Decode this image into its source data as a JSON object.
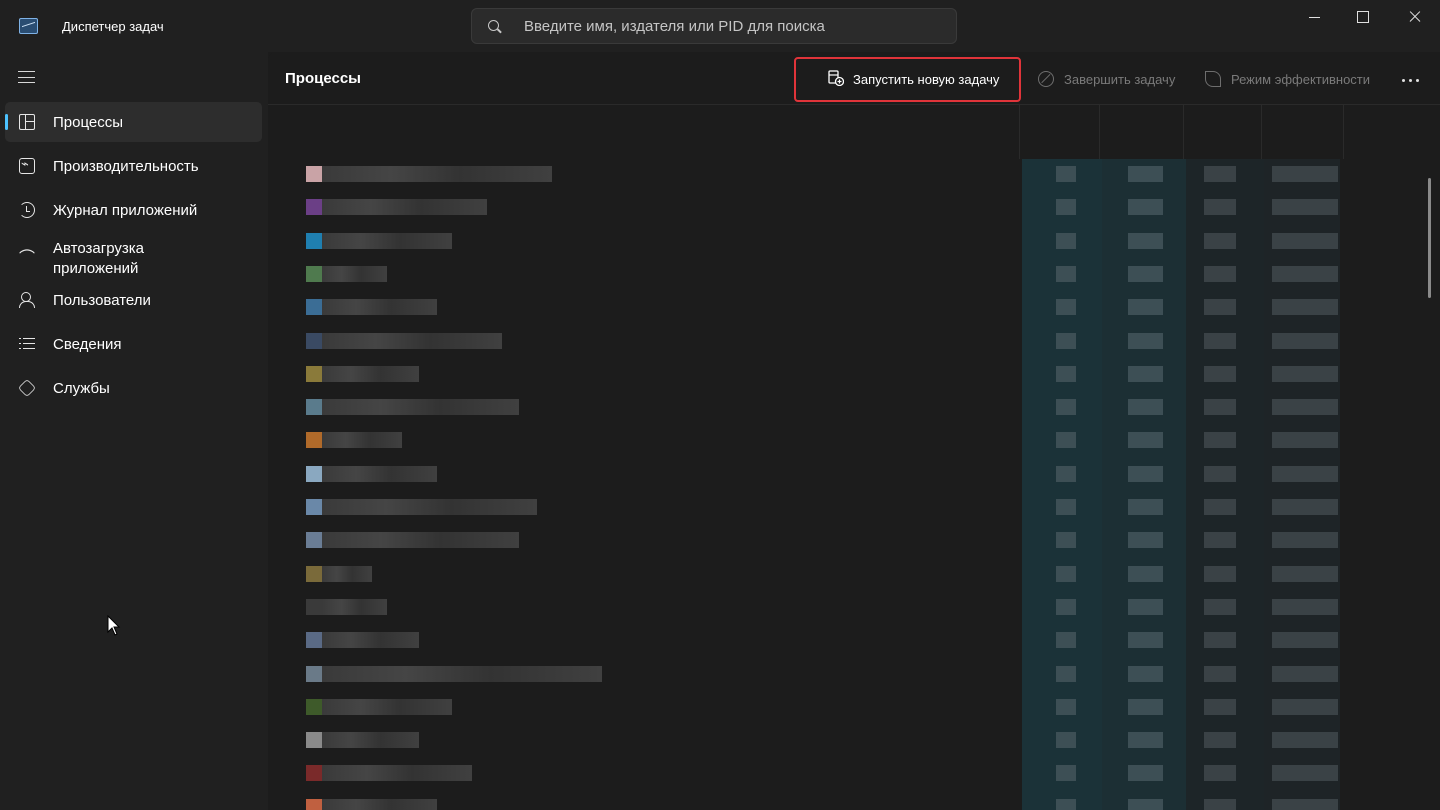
{
  "window": {
    "title": "Диспетчер задач",
    "search_placeholder": "Введите имя, издателя или PID для поиска"
  },
  "sidebar": {
    "items": [
      {
        "label": "Процессы",
        "icon": "processes-icon",
        "active": true
      },
      {
        "label": "Производительность",
        "icon": "performance-icon"
      },
      {
        "label": "Журнал приложений",
        "icon": "app-history-icon"
      },
      {
        "label": "Автозагрузка приложений",
        "icon": "startup-apps-icon"
      },
      {
        "label": "Пользователи",
        "icon": "users-icon"
      },
      {
        "label": "Сведения",
        "icon": "details-icon"
      },
      {
        "label": "Службы",
        "icon": "services-icon"
      }
    ]
  },
  "main": {
    "title": "Процессы",
    "toolbar": {
      "run_new_task": "Запустить новую задачу",
      "end_task": "Завершить задачу",
      "efficiency_mode": "Режим эффективности"
    }
  },
  "colors": {
    "accent": "#4cc2ff",
    "highlight": "#e0343a",
    "background": "#1c1c1c",
    "sidebar": "#202020"
  }
}
